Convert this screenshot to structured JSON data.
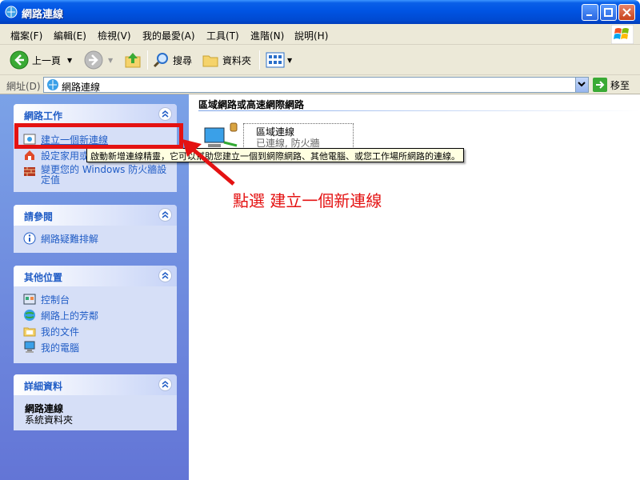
{
  "window": {
    "title": "網路連線"
  },
  "menu": [
    "檔案(F)",
    "編輯(E)",
    "檢視(V)",
    "我的最愛(A)",
    "工具(T)",
    "進階(N)",
    "說明(H)"
  ],
  "toolbar": {
    "back": "上一頁",
    "search": "搜尋",
    "folders": "資料夾"
  },
  "address": {
    "label": "網址(D)",
    "value": "網路連線",
    "go": "移至"
  },
  "left": {
    "network_tasks": {
      "title": "網路工作",
      "items": [
        "建立一個新連線",
        "設定家用或",
        "變更您的 Windows 防火牆設\n定值"
      ]
    },
    "see_also": {
      "title": "請參閱",
      "items": [
        "網路疑難排解"
      ]
    },
    "other_places": {
      "title": "其他位置",
      "items": [
        "控制台",
        "網路上的芳鄰",
        "我的文件",
        "我的電腦"
      ]
    },
    "details": {
      "title": "詳細資料",
      "name": "網路連線",
      "type": "系統資料夾"
    }
  },
  "main": {
    "section_title": "區域網路或高速網際網路",
    "connection": {
      "name": "區域連線",
      "status": "已連線, 防火牆"
    }
  },
  "tooltip": "啟動新增連線精靈，它可以幫助您建立一個到網際網路、其他電腦、或您工作場所網路的連線。",
  "annotation": "點選 建立一個新連線",
  "colors": {
    "title_bar": "#0054e3",
    "annotation": "#e41212",
    "link": "#215dc6"
  }
}
